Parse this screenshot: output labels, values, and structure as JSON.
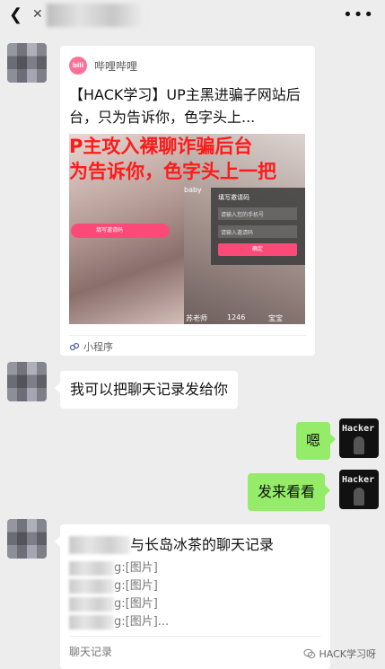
{
  "topbar": {
    "back_icon": "back-arrow-icon",
    "more_icon": "more-icon"
  },
  "card": {
    "source_logo": "bilibili",
    "source": "哔哩哔哩",
    "title": "【HACK学习】UP主黑进骗子网站后台，只为告诉你，色字头上...",
    "thumb_banner_line1": "P主攻入裸聊诈骗后台",
    "thumb_banner_line2": "为告诉你，色字头上一把",
    "thumb_dialog_title": "填写邀请码",
    "thumb_dialog_input1": "请输入您的手机号",
    "thumb_dialog_input2": "请输入邀请码",
    "thumb_dialog_btn": "确定",
    "thumb_pink_btn": "填写邀请码",
    "thumb_baby": "baby",
    "thumb_caption1": "苏老师",
    "thumb_caption2": "1246",
    "thumb_caption3": "宝宝",
    "footer": "小程序"
  },
  "messages": {
    "left1": "我可以把聊天记录发给你",
    "right1": "嗯",
    "right2": "发来看看"
  },
  "record": {
    "title_suffix": "与长岛冰茶的聊天记录",
    "lines": [
      "g:[图片]",
      "g:[图片]",
      "g:[图片]",
      "g:[图片]..."
    ],
    "footer": "聊天记录"
  },
  "avatar_self_label": "Hacker",
  "watermark": "HACK学习呀"
}
